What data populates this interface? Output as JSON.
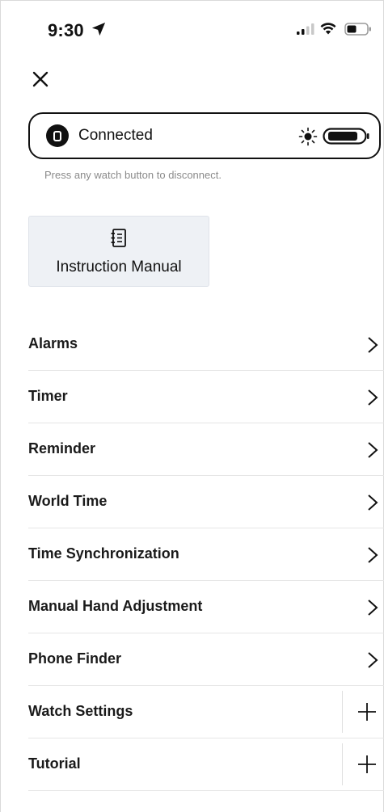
{
  "status_bar": {
    "time": "9:30",
    "icons": [
      "location-arrow-icon",
      "signal-icon",
      "wifi-icon",
      "battery-icon"
    ]
  },
  "connection": {
    "status": "Connected",
    "hint": "Press any watch button to disconnect.",
    "icons": [
      "watch-icon",
      "sun-icon",
      "watch-battery-icon"
    ]
  },
  "manual": {
    "label": "Instruction Manual",
    "icon": "notebook-icon"
  },
  "menu": {
    "items": [
      {
        "label": "Alarms",
        "action": "chevron"
      },
      {
        "label": "Timer",
        "action": "chevron"
      },
      {
        "label": "Reminder",
        "action": "chevron"
      },
      {
        "label": "World Time",
        "action": "chevron"
      },
      {
        "label": "Time Synchronization",
        "action": "chevron"
      },
      {
        "label": "Manual Hand Adjustment",
        "action": "chevron"
      },
      {
        "label": "Phone Finder",
        "action": "chevron"
      },
      {
        "label": "Watch Settings",
        "action": "plus"
      },
      {
        "label": "Tutorial",
        "action": "plus"
      }
    ]
  },
  "colors": {
    "text": "#111111",
    "hint": "#8a8a8a",
    "card_bg": "#eef1f5",
    "divider": "#e6e6e6"
  }
}
